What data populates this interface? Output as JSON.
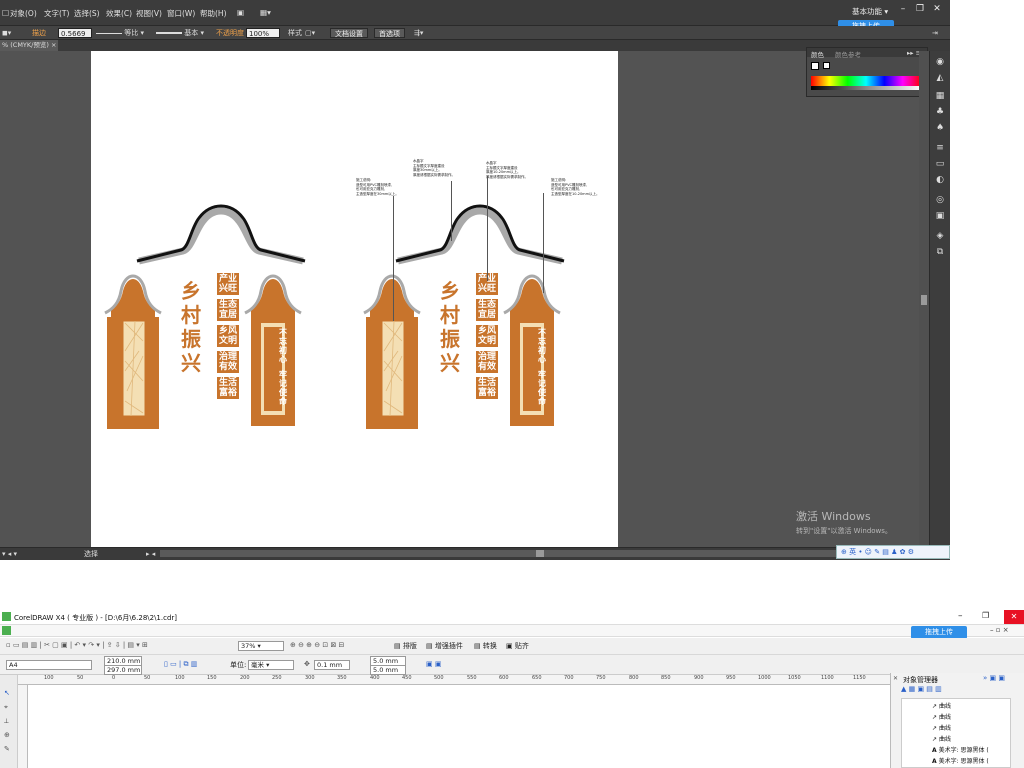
{
  "illustrator": {
    "menu": [
      "对象(O)",
      "文字(T)",
      "选择(S)",
      "效果(C)",
      "视图(V)",
      "窗口(W)",
      "帮助(H)"
    ],
    "workspace": "基本功能",
    "upload_label": "拖拽上传",
    "control": {
      "stroke_label": "描边",
      "stroke_weight": "0.5669",
      "stroke_profile": "等比",
      "brush": "基本",
      "opacity_label": "不透明度",
      "opacity_value": "100%",
      "style_label": "样式",
      "doc_setup": "文档设置",
      "preferences": "首选项"
    },
    "doc_tab": "% (CMYK/预览)",
    "color_panel": {
      "tab_color": "颜色",
      "tab_guide": "颜色参考"
    },
    "status_text": "选择",
    "activation": {
      "title": "激活 Windows",
      "subtitle": "转到\"设置\"以激活 Windows。"
    },
    "ime_label": "英"
  },
  "artwork": {
    "title_chars": [
      "乡",
      "村",
      "振",
      "兴"
    ],
    "slogans": [
      "产业兴旺",
      "生态宜居",
      "乡风文明",
      "治理有效",
      "生活富裕"
    ],
    "panel_text": [
      "不忘初心",
      "牢记使命"
    ],
    "callouts": [
      "施工说明:\n造型可用PVC雕刻喷漆,\n也可用亚克力雕刻,\n主造型厚度在30mm以上。",
      "水晶字\n主标题文字厚度建设\n厚度30mm以上。\n厚度请根据实际需求制作。",
      "水晶字\n主标题文字厚度建设\n厚度10-20mm以上。\n厚度请根据实际需求制作。",
      "施工说明:\n造型可用PVC雕刻喷漆,\n也可用亚克力雕刻,\n主造型厚度在10-20mm以上。"
    ],
    "colors": {
      "orange": "#c8742c",
      "cream": "#f4dfb4",
      "gray": "#a9a9a9",
      "black": "#111111"
    }
  },
  "coreldraw": {
    "title": "CorelDRAW X4 ( 专业版 ) - [D:\\6月\\6.28\\2\\1.cdr]",
    "upload_label": "拖拽上传",
    "zoom": "37%",
    "toolbar_buttons": [
      "排版",
      "增强插件",
      "转换",
      "贴齐"
    ],
    "page_size": "A4",
    "width": "210.0 mm",
    "height": "297.0 mm",
    "units_label": "单位:",
    "units": "毫米",
    "nudge": "0.1 mm",
    "dup_x": "5.0 mm",
    "dup_y": "5.0 mm",
    "ruler": [
      "100",
      "50",
      "0",
      "50",
      "100",
      "150",
      "200",
      "250",
      "300",
      "350",
      "400",
      "450",
      "500",
      "550",
      "600",
      "650",
      "700",
      "750",
      "800",
      "850",
      "900",
      "950",
      "1000",
      "1050",
      "1100",
      "1150"
    ],
    "docker_title": "对象管理器",
    "objects": [
      "曲线",
      "曲线",
      "曲线",
      "曲线",
      "美术字: 思源黑体 (",
      "美术字: 思源黑体 ("
    ]
  }
}
